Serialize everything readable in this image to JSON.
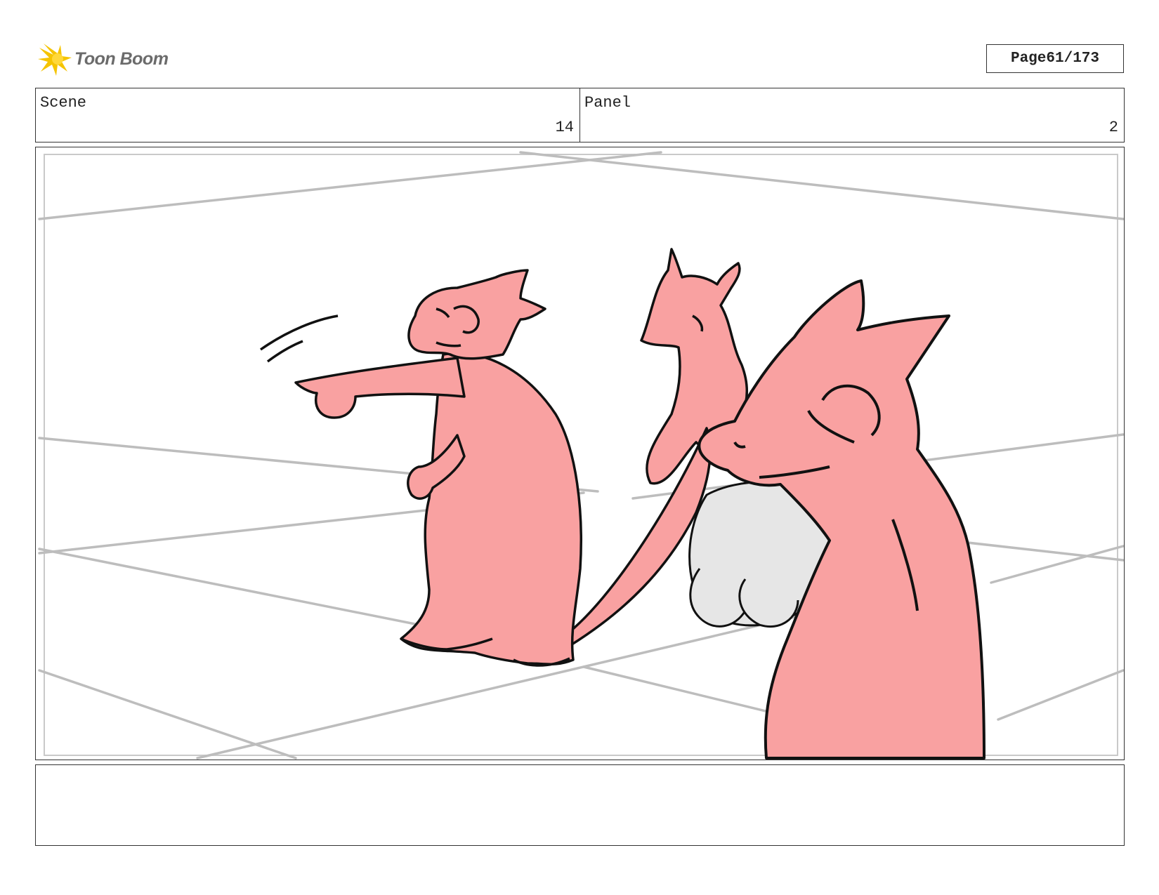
{
  "header": {
    "logo_text": "Toon Boom",
    "page_label": "Page",
    "page_value": "61/173"
  },
  "scene": {
    "label": "Scene",
    "value": "14"
  },
  "panel": {
    "label": "Panel",
    "value": "2"
  },
  "notes": {
    "text": ""
  },
  "colors": {
    "character_fill": "#f9a1a1",
    "shell_fill": "#e6e6e6",
    "guide_lines": "#bdbdbd",
    "logo_yellow": "#f5c400"
  }
}
